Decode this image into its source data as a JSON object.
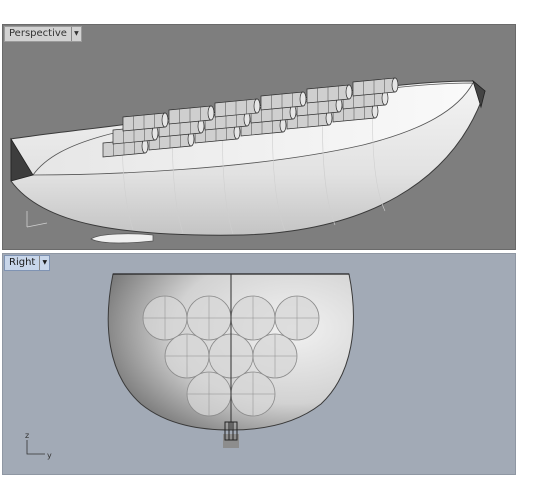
{
  "viewports": {
    "perspective": {
      "label": "Perspective",
      "active": false,
      "background": "#7e7e7e"
    },
    "right": {
      "label": "Right",
      "active": true,
      "background": "#a2aab6"
    }
  },
  "axes": {
    "perspective": {
      "vertical": "",
      "horizontal": ""
    },
    "right": {
      "vertical": "z",
      "horizontal": "y"
    }
  },
  "icons": [
    "dropdown-arrow-icon",
    "axis-triad-icon"
  ],
  "colors": {
    "hull_fill": "#e8e8e8",
    "tank_fill": "#d4d4d4",
    "outline": "#3a3a3a"
  }
}
